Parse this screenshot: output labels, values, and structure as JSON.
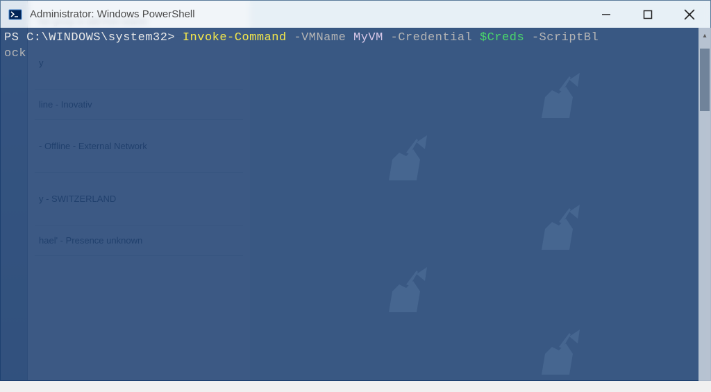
{
  "window": {
    "title": "Administrator: Windows PowerShell"
  },
  "terminal": {
    "prompt": "PS C:\\WINDOWS\\system32>",
    "cmdlet": "Invoke-Command",
    "param_vmname": "-VMName",
    "arg_vmname": "MyVM",
    "param_credential": "-Credential",
    "var_creds": "$Creds",
    "param_scriptblock_part1": "-ScriptBl",
    "param_scriptblock_part2": "ock"
  },
  "background": {
    "header_hint": "her group or add from search",
    "items": [
      "y",
      "line - Inovativ",
      " - Offline - External Network",
      "y - SWITZERLAND",
      "hael' - Presence unknown"
    ]
  },
  "controls": {
    "minimize": "minimize",
    "maximize": "maximize",
    "close": "close"
  }
}
